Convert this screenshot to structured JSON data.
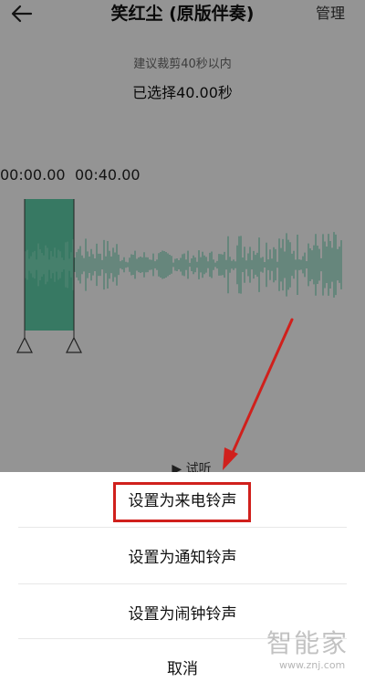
{
  "header": {
    "title": "笑红尘 (原版伴奏)",
    "manage_label": "管理",
    "back_icon": "arrow-left-icon"
  },
  "trim": {
    "hint": "建议裁剪40秒以内",
    "selected": "已选择40.00秒",
    "start_time": "00:00.00",
    "end_time": "00:40.00",
    "selection_color": "#5ccaa6",
    "wave_color": "#5ccaa6"
  },
  "preview": {
    "label": "试听",
    "icon": "play-icon"
  },
  "sheet": {
    "options": [
      "设置为来电铃声",
      "设置为通知铃声",
      "设置为闹钟铃声",
      "取消"
    ],
    "highlight_color": "#d0201c"
  },
  "watermark": {
    "text": "智能家",
    "url": "www.znj.com"
  }
}
